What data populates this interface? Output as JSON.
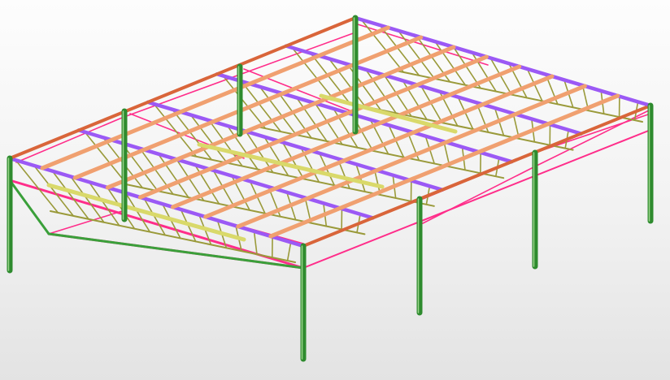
{
  "viewport": {
    "background_top": "#fdfdfd",
    "background_bottom": "#e3e3e3"
  },
  "member_colors": {
    "column": "#2e8b2e",
    "column_highlight": "#9ad48a",
    "rafter_chord": "#9b59f5",
    "top_chord": "#d9653a",
    "purlin": "#f0a070",
    "brace": "#ff2d8a",
    "truss_web": "#9a9a3a",
    "ridge_girder": "#d9d96a",
    "eave_tie": "#3aa03a"
  }
}
